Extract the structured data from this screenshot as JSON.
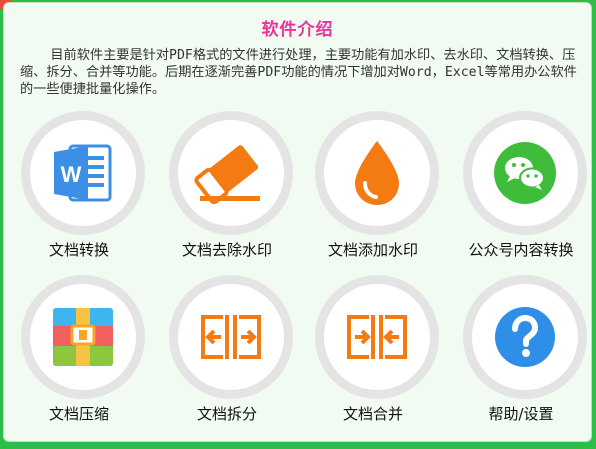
{
  "window": {
    "title": "软件介绍",
    "intro": "目前软件主要是针对PDF格式的文件进行处理，主要功能有加水印、去水印、文档转换、压缩、拆分、合并等功能。后期在逐渐完善PDF功能的情况下增加对Word，Excel等常用办公软件的一些便捷批量化操作。"
  },
  "features": [
    {
      "label": "文档转换",
      "icon": "word-document-icon"
    },
    {
      "label": "文档去除水印",
      "icon": "eraser-icon"
    },
    {
      "label": "文档添加水印",
      "icon": "water-drop-icon"
    },
    {
      "label": "公众号内容转换",
      "icon": "wechat-icon"
    },
    {
      "label": "文档压缩",
      "icon": "archive-box-icon"
    },
    {
      "label": "文档拆分",
      "icon": "split-icon"
    },
    {
      "label": "文档合并",
      "icon": "merge-icon"
    },
    {
      "label": "帮助/设置",
      "icon": "help-icon"
    }
  ],
  "colors": {
    "frame": "#2bbf4a",
    "panel": "#f2fbf1",
    "title": "#e8359a",
    "orange": "#f47a12",
    "word_blue": "#3d8fe6",
    "wechat_green": "#3fbd3a",
    "help_blue": "#2f8ee8"
  }
}
